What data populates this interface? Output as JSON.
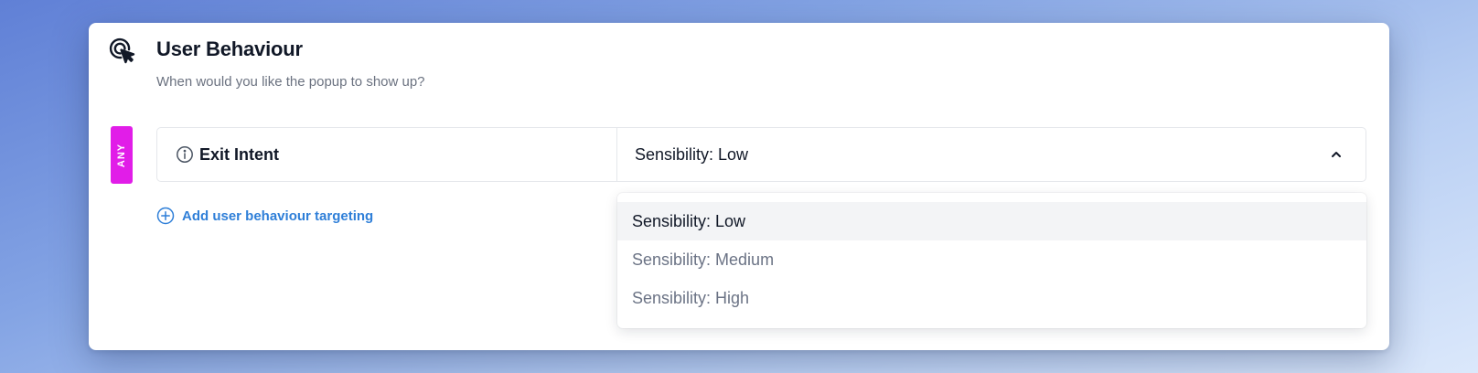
{
  "section": {
    "title": "User Behaviour",
    "subtitle": "When would you like the popup to show up?",
    "icon": "cursor-click-icon"
  },
  "rule_group": {
    "match_badge": "ANY",
    "badge_color": "#e11de8",
    "rules": [
      {
        "label": "Exit Intent",
        "info_icon": "info-icon",
        "selected_value": "Sensibility: Low"
      }
    ]
  },
  "add_link": {
    "label": "Add user behaviour targeting",
    "icon": "plus-circle-icon",
    "color": "#2f7fd8"
  },
  "dropdown": {
    "open": true,
    "options": [
      {
        "label": "Sensibility: Low",
        "selected": true
      },
      {
        "label": "Sensibility: Medium",
        "selected": false
      },
      {
        "label": "Sensibility: High",
        "selected": false
      }
    ]
  }
}
